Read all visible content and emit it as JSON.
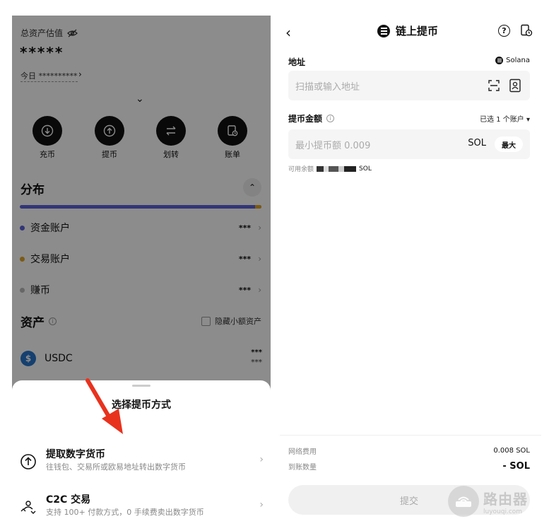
{
  "left": {
    "asset_estimate_label": "总资产估值",
    "hidden_balance": "*****",
    "today_label": "今日 **********",
    "actions": [
      {
        "label": "充币",
        "icon": "deposit-icon"
      },
      {
        "label": "提币",
        "icon": "withdraw-icon"
      },
      {
        "label": "划转",
        "icon": "transfer-icon"
      },
      {
        "label": "账单",
        "icon": "bill-icon"
      }
    ],
    "distribution_title": "分布",
    "accounts": [
      {
        "name": "资金账户",
        "value": "***",
        "color": "#5b61d9"
      },
      {
        "name": "交易账户",
        "value": "***",
        "color": "#e0a526"
      },
      {
        "name": "赚币",
        "value": "***",
        "color": "#bbbbbb"
      }
    ],
    "assets_title": "资产",
    "hide_small_label": "隐藏小额资产",
    "coins": [
      {
        "symbol": "USDC",
        "value": "***",
        "sub_value": "***"
      }
    ],
    "sheet": {
      "title": "选择提币方式",
      "options": [
        {
          "title": "提取数字货币",
          "subtitle": "往钱包、交易所或欧易地址转出数字货币",
          "icon": "upload-circle-icon"
        },
        {
          "title": "C2C 交易",
          "subtitle": "支持 100+ 付款方式，0 手续费卖出数字货币",
          "icon": "c2c-users-icon"
        }
      ]
    }
  },
  "right": {
    "title": "链上提币",
    "address_label": "地址",
    "network": "Solana",
    "address_placeholder": "扫描或输入地址",
    "amount_label": "提币金额",
    "account_select": "已选 1 个账户 ▾",
    "amount_placeholder": "最小提币额 0.009",
    "amount_unit": "SOL",
    "max_label": "最大",
    "available_label": "可用余额",
    "available_unit": "SOL",
    "fee_label": "网络费用",
    "fee_value": "0.008 SOL",
    "receive_label": "到账数量",
    "receive_value": "- SOL",
    "submit_label": "提交"
  },
  "watermark": {
    "cn": "路由器",
    "en": "luyouqi.com"
  },
  "colors": {
    "fund_account": "#5b61d9",
    "trade_account": "#e0a526",
    "annotation_arrow": "#e8321e"
  }
}
